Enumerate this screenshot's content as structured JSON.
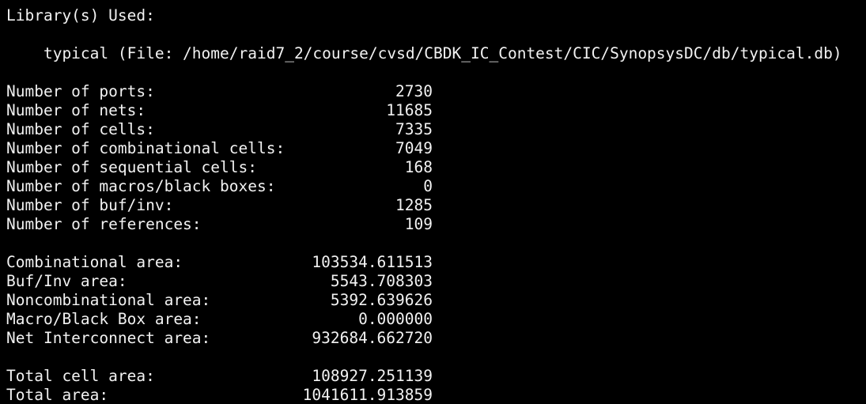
{
  "header": {
    "title": "Library(s) Used:",
    "library_line": "    typical (File: /home/raid7_2/course/cvsd/CBDK_IC_Contest/CIC/SynopsysDC/db/typical.db)"
  },
  "counts": [
    {
      "label": "Number of ports:",
      "value": "2730"
    },
    {
      "label": "Number of nets:",
      "value": "11685"
    },
    {
      "label": "Number of cells:",
      "value": "7335"
    },
    {
      "label": "Number of combinational cells:",
      "value": "7049"
    },
    {
      "label": "Number of sequential cells:",
      "value": "168"
    },
    {
      "label": "Number of macros/black boxes:",
      "value": "0"
    },
    {
      "label": "Number of buf/inv:",
      "value": "1285"
    },
    {
      "label": "Number of references:",
      "value": "109"
    }
  ],
  "areas": [
    {
      "label": "Combinational area:",
      "value": "103534.611513"
    },
    {
      "label": "Buf/Inv area:",
      "value": "5543.708303"
    },
    {
      "label": "Noncombinational area:",
      "value": "5392.639626"
    },
    {
      "label": "Macro/Black Box area:",
      "value": "0.000000"
    },
    {
      "label": "Net Interconnect area:",
      "value": "932684.662720"
    }
  ],
  "totals": [
    {
      "label": "Total cell area:",
      "value": "108927.251139"
    },
    {
      "label": "Total area:",
      "value": "1041611.913859"
    }
  ],
  "colors": {
    "background": "#000000",
    "text": "#f2f2f2"
  }
}
